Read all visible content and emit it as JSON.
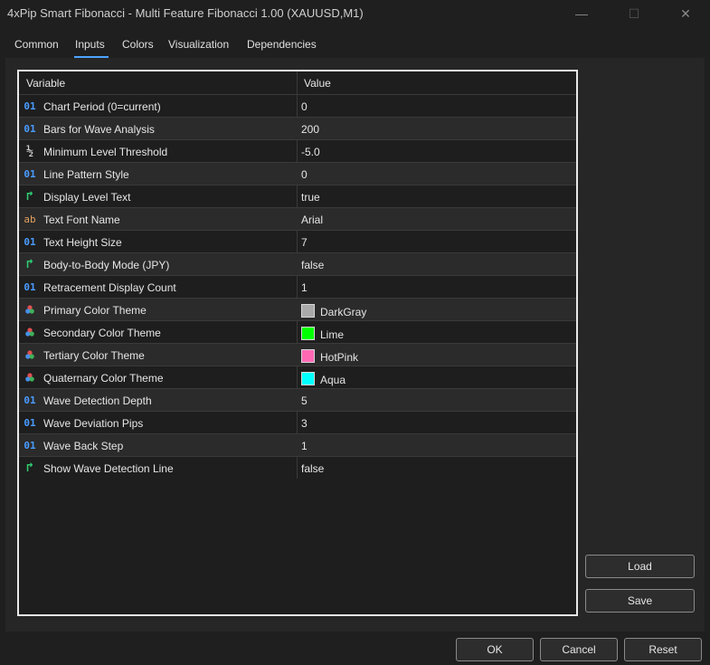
{
  "window": {
    "title": "4xPip Smart Fibonacci - Multi Feature Fibonacci 1.00 (XAUUSD,M1)",
    "minimize_glyph": "—",
    "maximize_glyph": "☐",
    "close_glyph": "✕"
  },
  "tabs": [
    {
      "label": "Common"
    },
    {
      "label": "Inputs"
    },
    {
      "label": "Colors"
    },
    {
      "label": "Visualization"
    },
    {
      "label": "Dependencies"
    }
  ],
  "active_tab": "Inputs",
  "grid": {
    "col_variable": "Variable",
    "col_value": "Value",
    "rows": [
      {
        "icon": "int-icon",
        "glyph": "01",
        "name": "Chart Period (0=current)",
        "value": "0"
      },
      {
        "icon": "int-icon",
        "glyph": "01",
        "name": "Bars for Wave Analysis",
        "value": "200"
      },
      {
        "icon": "double-icon",
        "glyph": "½",
        "name": "Minimum Level Threshold",
        "value": "-5.0"
      },
      {
        "icon": "int-icon",
        "glyph": "01",
        "name": "Line Pattern Style",
        "value": "0"
      },
      {
        "icon": "bool-icon",
        "glyph": "↱",
        "name": "Display Level Text",
        "value": "true"
      },
      {
        "icon": "string-icon",
        "glyph": "ab",
        "name": "Text Font Name",
        "value": "Arial"
      },
      {
        "icon": "int-icon",
        "glyph": "01",
        "name": "Text Height Size",
        "value": "7"
      },
      {
        "icon": "bool-icon",
        "glyph": "↱",
        "name": "Body-to-Body Mode (JPY)",
        "value": "false"
      },
      {
        "icon": "int-icon",
        "glyph": "01",
        "name": "Retracement Display Count",
        "value": "1"
      },
      {
        "icon": "color-icon",
        "glyph": "",
        "name": "Primary Color Theme",
        "value": "DarkGray",
        "swatch": "#a9a9a9"
      },
      {
        "icon": "color-icon",
        "glyph": "",
        "name": "Secondary Color Theme",
        "value": "Lime",
        "swatch": "#00ff00"
      },
      {
        "icon": "color-icon",
        "glyph": "",
        "name": "Tertiary Color Theme",
        "value": "HotPink",
        "swatch": "#ff69b4"
      },
      {
        "icon": "color-icon",
        "glyph": "",
        "name": "Quaternary Color Theme",
        "value": "Aqua",
        "swatch": "#00ffff"
      },
      {
        "icon": "int-icon",
        "glyph": "01",
        "name": "Wave Detection Depth",
        "value": "5"
      },
      {
        "icon": "int-icon",
        "glyph": "01",
        "name": "Wave Deviation Pips",
        "value": "3"
      },
      {
        "icon": "int-icon",
        "glyph": "01",
        "name": "Wave Back Step",
        "value": "1"
      },
      {
        "icon": "bool-icon",
        "glyph": "↱",
        "name": "Show Wave Detection Line",
        "value": "false"
      }
    ]
  },
  "buttons": {
    "load": "Load",
    "save": "Save",
    "ok": "OK",
    "cancel": "Cancel",
    "reset": "Reset"
  },
  "colors": {
    "accent": "#4da3ff",
    "int_icon": "#4a9cff",
    "bool_icon": "#2ecc71",
    "string_icon": "#e0a060"
  }
}
